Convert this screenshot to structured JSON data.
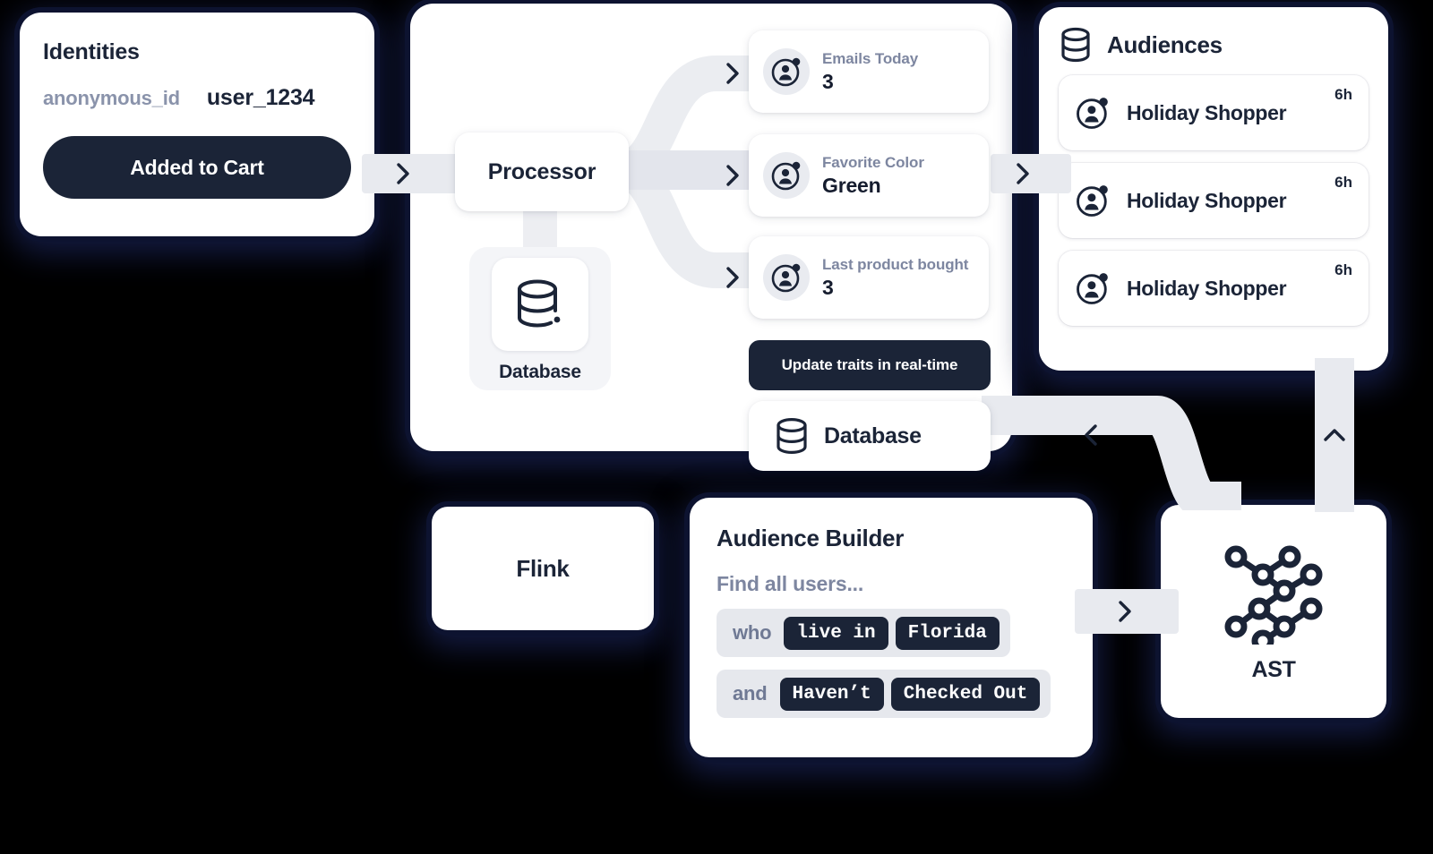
{
  "identities": {
    "title": "Identities",
    "key": "anonymous_id",
    "value": "user_1234",
    "button_label": "Added to Cart"
  },
  "pipeline": {
    "processor_label": "Processor",
    "database_label": "Database",
    "database_icon": "database-icon",
    "tooltip": "Update traits in real-time",
    "output_database_label": "Database",
    "traits": [
      {
        "label": "Emails Today",
        "value": "3",
        "icon": "user-profile-icon"
      },
      {
        "label": "Favorite Color",
        "value": "Green",
        "icon": "user-profile-icon"
      },
      {
        "label": "Last product bought",
        "value": "3",
        "icon": "user-profile-icon"
      }
    ]
  },
  "audiences": {
    "title": "Audiences",
    "icon": "database-icon",
    "items": [
      {
        "name": "Holiday Shopper",
        "age": "6h",
        "icon": "user-profile-icon"
      },
      {
        "name": "Holiday Shopper",
        "age": "6h",
        "icon": "user-profile-icon"
      },
      {
        "name": "Holiday Shopper",
        "age": "6h",
        "icon": "user-profile-icon"
      }
    ]
  },
  "flink": {
    "label": "Flink"
  },
  "builder": {
    "title": "Audience Builder",
    "subtitle": "Find all users...",
    "rows": [
      {
        "connector": "who",
        "chips": [
          "live in",
          "Florida"
        ]
      },
      {
        "connector": "and",
        "chips": [
          "Haven’t",
          "Checked Out"
        ]
      }
    ]
  },
  "ast": {
    "label": "AST",
    "icon": "node-graph-icon"
  },
  "connectors": [
    {
      "name": "identities-to-processor",
      "glyph": "chevron-right"
    },
    {
      "name": "processor-to-trait-1",
      "glyph": "chevron-right"
    },
    {
      "name": "processor-to-trait-2",
      "glyph": "chevron-right"
    },
    {
      "name": "processor-to-trait-3",
      "glyph": "chevron-right"
    },
    {
      "name": "traits-to-audiences",
      "glyph": "chevron-right"
    },
    {
      "name": "audiences-to-ast",
      "glyph": "chevron-up"
    },
    {
      "name": "ast-to-database",
      "glyph": "chevron-left"
    },
    {
      "name": "builder-to-ast",
      "glyph": "chevron-right"
    }
  ],
  "colors": {
    "background": "#000000",
    "card": "#ffffff",
    "ink": "#1b2437",
    "muted": "#7d86a0",
    "rail": "#e8eaef",
    "glow": "#131a40"
  }
}
